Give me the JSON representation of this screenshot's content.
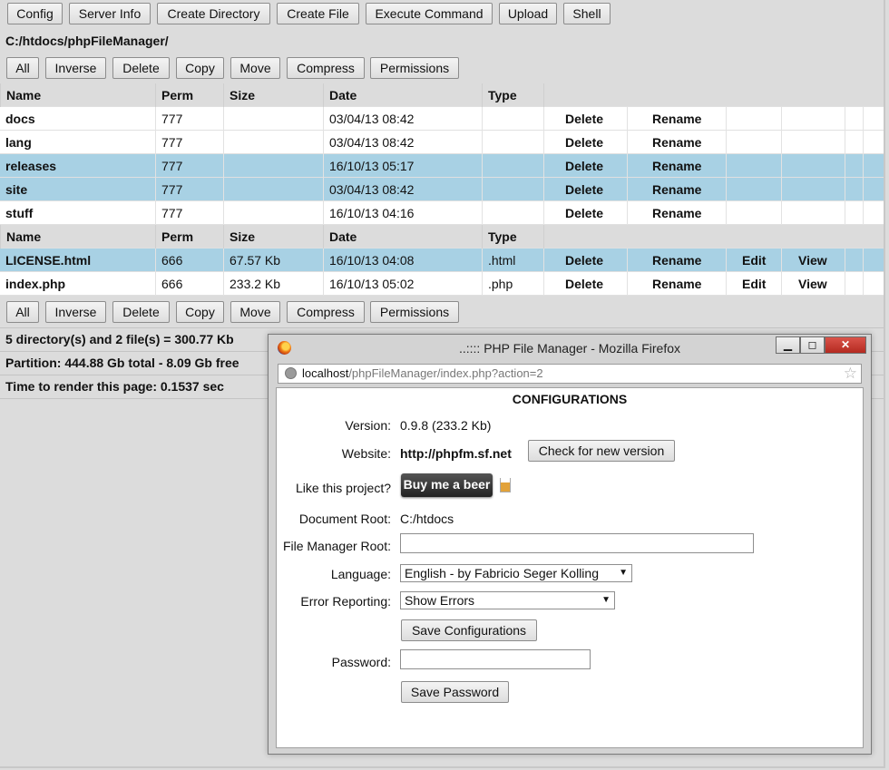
{
  "toolbar": {
    "buttons": [
      "Config",
      "Server Info",
      "Create Directory",
      "Create File",
      "Execute Command",
      "Upload",
      "Shell"
    ]
  },
  "current_path": "C:/htdocs/phpFileManager/",
  "actions": [
    "All",
    "Inverse",
    "Delete",
    "Copy",
    "Move",
    "Compress",
    "Permissions"
  ],
  "table": {
    "headers": {
      "name": "Name",
      "perm": "Perm",
      "size": "Size",
      "date": "Date",
      "type": "Type"
    },
    "directories": [
      {
        "name": "docs",
        "perm": "777",
        "size": "",
        "date": "03/04/13 08:42",
        "type": "",
        "delete": "Delete",
        "rename": "Rename",
        "selected": false
      },
      {
        "name": "lang",
        "perm": "777",
        "size": "",
        "date": "03/04/13 08:42",
        "type": "",
        "delete": "Delete",
        "rename": "Rename",
        "selected": false
      },
      {
        "name": "releases",
        "perm": "777",
        "size": "",
        "date": "16/10/13 05:17",
        "type": "",
        "delete": "Delete",
        "rename": "Rename",
        "selected": true
      },
      {
        "name": "site",
        "perm": "777",
        "size": "",
        "date": "03/04/13 08:42",
        "type": "",
        "delete": "Delete",
        "rename": "Rename",
        "selected": true
      },
      {
        "name": "stuff",
        "perm": "777",
        "size": "",
        "date": "16/10/13 04:16",
        "type": "",
        "delete": "Delete",
        "rename": "Rename",
        "selected": false
      }
    ],
    "files": [
      {
        "name": "LICENSE.html",
        "perm": "666",
        "size": "67.57 Kb",
        "date": "16/10/13 04:08",
        "type": ".html",
        "delete": "Delete",
        "rename": "Rename",
        "edit": "Edit",
        "view": "View",
        "selected": true
      },
      {
        "name": "index.php",
        "perm": "666",
        "size": "233.2 Kb",
        "date": "16/10/13 05:02",
        "type": ".php",
        "delete": "Delete",
        "rename": "Rename",
        "edit": "Edit",
        "view": "View",
        "selected": false
      }
    ]
  },
  "summary": {
    "counts": "5 directory(s) and 2 file(s) = 300.77 Kb",
    "partition": "Partition: 444.88 Gb total - 8.09 Gb free",
    "render_time": "Time to render this page: 0.1537 sec"
  },
  "popup": {
    "title": "..:::: PHP File Manager - Mozilla Firefox",
    "url_host": "localhost",
    "url_rest": "/phpFileManager/index.php?action=2",
    "heading": "CONFIGURATIONS",
    "version_label": "Version:",
    "version_value": "0.9.8 (233.2 Kb)",
    "website_label": "Website:",
    "website_value": "http://phpfm.sf.net",
    "check_version_button": "Check for new version",
    "like_label": "Like this project?",
    "beer_button": "Buy me a beer",
    "doc_root_label": "Document Root:",
    "doc_root_value": "C:/htdocs",
    "fm_root_label": "File Manager Root:",
    "fm_root_value": "",
    "language_label": "Language:",
    "language_value": "English - by Fabricio Seger Kolling",
    "error_label": "Error Reporting:",
    "error_value": "Show Errors",
    "save_config_button": "Save Configurations",
    "password_label": "Password:",
    "password_value": "",
    "save_password_button": "Save Password"
  }
}
